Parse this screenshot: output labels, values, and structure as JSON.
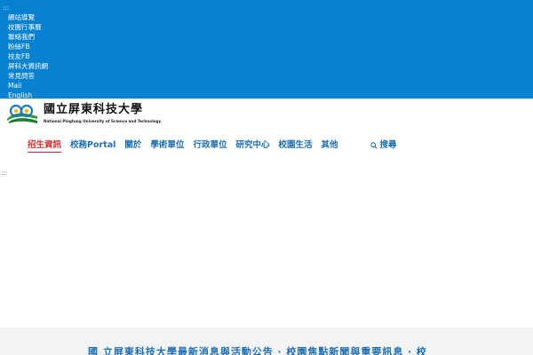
{
  "access_key_top": ":::",
  "top_links": [
    {
      "label": "網站導覽"
    },
    {
      "label": "校園行事曆"
    },
    {
      "label": "聯絡我們"
    },
    {
      "label": "粉絲FB"
    },
    {
      "label": "校友FB"
    },
    {
      "label": "屏科大資訊網"
    },
    {
      "label": "常見問答"
    },
    {
      "label": "Mail"
    },
    {
      "label": "English"
    }
  ],
  "logo": {
    "title": "國立屏東科技大學",
    "subtitle": "National Pingtung University of Science and Technology"
  },
  "nav": {
    "items": [
      {
        "label": "招生資訊",
        "highlight": true
      },
      {
        "label": "校務Portal"
      },
      {
        "label": "關於"
      },
      {
        "label": "學術單位"
      },
      {
        "label": "行政單位"
      },
      {
        "label": "研究中心"
      },
      {
        "label": "校園生活"
      },
      {
        "label": "其他"
      }
    ],
    "tool_label": "搜尋"
  },
  "access_key_main": ":::",
  "footer_text": "國 立屏東科技大學最新消息與活動公告 ‧ 校園焦點新聞與重要訊息 ‧ 校"
}
